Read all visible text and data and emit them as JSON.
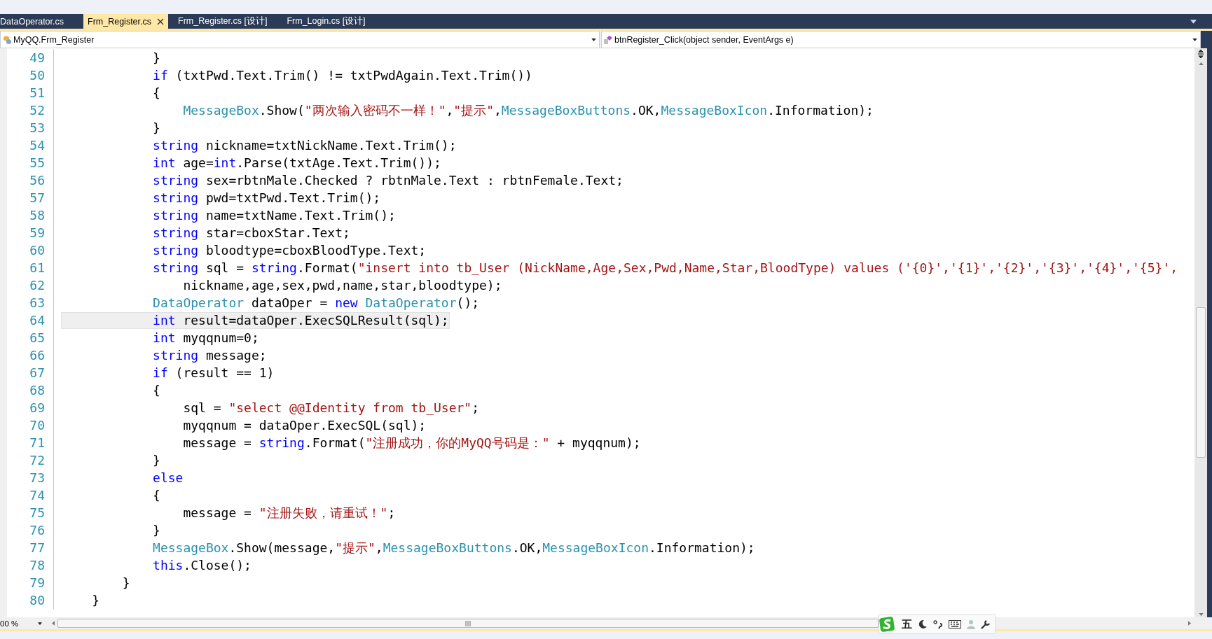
{
  "tabs": [
    {
      "label": "DataOperator.cs",
      "selected": false
    },
    {
      "label": "Frm_Register.cs",
      "selected": true
    },
    {
      "label": "Frm_Register.cs [设计]",
      "selected": false
    },
    {
      "label": "Frm_Login.cs [设计]",
      "selected": false
    }
  ],
  "navigation": {
    "class_combo": "MyQQ.Frm_Register",
    "member_combo": "btnRegister_Click(object sender, EventArgs e)"
  },
  "code_lines": [
    {
      "number": "49",
      "current": false,
      "tokens": [
        {
          "kind": "plain",
          "text": "            }"
        }
      ]
    },
    {
      "number": "50",
      "current": false,
      "tokens": [
        {
          "kind": "keyword",
          "text": "            if"
        },
        {
          "kind": "plain",
          "text": " (txtPwd.Text.Trim() != txtPwdAgain.Text.Trim())"
        }
      ]
    },
    {
      "number": "51",
      "current": false,
      "tokens": [
        {
          "kind": "plain",
          "text": "            {"
        }
      ]
    },
    {
      "number": "52",
      "current": false,
      "tokens": [
        {
          "kind": "type",
          "text": "                MessageBox"
        },
        {
          "kind": "plain",
          "text": ".Show("
        },
        {
          "kind": "string",
          "text": "\"两次输入密码不一样！\""
        },
        {
          "kind": "plain",
          "text": ","
        },
        {
          "kind": "string",
          "text": "\"提示\""
        },
        {
          "kind": "plain",
          "text": ","
        },
        {
          "kind": "type",
          "text": "MessageBoxButtons"
        },
        {
          "kind": "plain",
          "text": ".OK,"
        },
        {
          "kind": "type",
          "text": "MessageBoxIcon"
        },
        {
          "kind": "plain",
          "text": ".Information);"
        }
      ]
    },
    {
      "number": "53",
      "current": false,
      "tokens": [
        {
          "kind": "plain",
          "text": "            }"
        }
      ]
    },
    {
      "number": "54",
      "current": false,
      "tokens": [
        {
          "kind": "keyword",
          "text": "            string"
        },
        {
          "kind": "plain",
          "text": " nickname=txtNickName.Text.Trim();"
        }
      ]
    },
    {
      "number": "55",
      "current": false,
      "tokens": [
        {
          "kind": "keyword",
          "text": "            int"
        },
        {
          "kind": "plain",
          "text": " age="
        },
        {
          "kind": "keyword",
          "text": "int"
        },
        {
          "kind": "plain",
          "text": ".Parse(txtAge.Text.Trim());"
        }
      ]
    },
    {
      "number": "56",
      "current": false,
      "tokens": [
        {
          "kind": "keyword",
          "text": "            string"
        },
        {
          "kind": "plain",
          "text": " sex=rbtnMale.Checked ? rbtnMale.Text : rbtnFemale.Text;"
        }
      ]
    },
    {
      "number": "57",
      "current": false,
      "tokens": [
        {
          "kind": "keyword",
          "text": "            string"
        },
        {
          "kind": "plain",
          "text": " pwd=txtPwd.Text.Trim();"
        }
      ]
    },
    {
      "number": "58",
      "current": false,
      "tokens": [
        {
          "kind": "keyword",
          "text": "            string"
        },
        {
          "kind": "plain",
          "text": " name=txtName.Text.Trim();"
        }
      ]
    },
    {
      "number": "59",
      "current": false,
      "tokens": [
        {
          "kind": "keyword",
          "text": "            string"
        },
        {
          "kind": "plain",
          "text": " star=cboxStar.Text;"
        }
      ]
    },
    {
      "number": "60",
      "current": false,
      "tokens": [
        {
          "kind": "keyword",
          "text": "            string"
        },
        {
          "kind": "plain",
          "text": " bloodtype=cboxBloodType.Text;"
        }
      ]
    },
    {
      "number": "61",
      "current": false,
      "tokens": [
        {
          "kind": "keyword",
          "text": "            string"
        },
        {
          "kind": "plain",
          "text": " sql = "
        },
        {
          "kind": "keyword",
          "text": "string"
        },
        {
          "kind": "plain",
          "text": ".Format("
        },
        {
          "kind": "string",
          "text": "\"insert into tb_User (NickName,Age,Sex,Pwd,Name,Star,BloodType) values ('{0}','{1}','{2}','{3}','{4}','{5}',"
        }
      ]
    },
    {
      "number": "62",
      "current": false,
      "tokens": [
        {
          "kind": "plain",
          "text": "                nickname,age,sex,pwd,name,star,bloodtype);"
        }
      ]
    },
    {
      "number": "63",
      "current": false,
      "tokens": [
        {
          "kind": "type",
          "text": "            DataOperator"
        },
        {
          "kind": "plain",
          "text": " dataOper = "
        },
        {
          "kind": "keyword",
          "text": "new"
        },
        {
          "kind": "type",
          "text": " DataOperator"
        },
        {
          "kind": "plain",
          "text": "();"
        }
      ]
    },
    {
      "number": "64",
      "current": true,
      "tokens": [
        {
          "kind": "keyword",
          "text": "            int"
        },
        {
          "kind": "plain",
          "text": " result=dataOper.ExecSQLResult(sql);"
        }
      ]
    },
    {
      "number": "65",
      "current": false,
      "tokens": [
        {
          "kind": "keyword",
          "text": "            int"
        },
        {
          "kind": "plain",
          "text": " myqqnum=0;"
        }
      ]
    },
    {
      "number": "66",
      "current": false,
      "tokens": [
        {
          "kind": "keyword",
          "text": "            string"
        },
        {
          "kind": "plain",
          "text": " message;"
        }
      ]
    },
    {
      "number": "67",
      "current": false,
      "tokens": [
        {
          "kind": "keyword",
          "text": "            if"
        },
        {
          "kind": "plain",
          "text": " (result == 1)"
        }
      ]
    },
    {
      "number": "68",
      "current": false,
      "tokens": [
        {
          "kind": "plain",
          "text": "            {"
        }
      ]
    },
    {
      "number": "69",
      "current": false,
      "tokens": [
        {
          "kind": "plain",
          "text": "                sql = "
        },
        {
          "kind": "string",
          "text": "\"select @@Identity from tb_User\""
        },
        {
          "kind": "plain",
          "text": ";"
        }
      ]
    },
    {
      "number": "70",
      "current": false,
      "tokens": [
        {
          "kind": "plain",
          "text": "                myqqnum = dataOper.ExecSQL(sql);"
        }
      ]
    },
    {
      "number": "71",
      "current": false,
      "tokens": [
        {
          "kind": "plain",
          "text": "                message = "
        },
        {
          "kind": "keyword",
          "text": "string"
        },
        {
          "kind": "plain",
          "text": ".Format("
        },
        {
          "kind": "string",
          "text": "\"注册成功，你的MyQQ号码是：\""
        },
        {
          "kind": "plain",
          "text": " + myqqnum);"
        }
      ]
    },
    {
      "number": "72",
      "current": false,
      "tokens": [
        {
          "kind": "plain",
          "text": "            }"
        }
      ]
    },
    {
      "number": "73",
      "current": false,
      "tokens": [
        {
          "kind": "keyword",
          "text": "            else"
        }
      ]
    },
    {
      "number": "74",
      "current": false,
      "tokens": [
        {
          "kind": "plain",
          "text": "            {"
        }
      ]
    },
    {
      "number": "75",
      "current": false,
      "tokens": [
        {
          "kind": "plain",
          "text": "                message = "
        },
        {
          "kind": "string",
          "text": "\"注册失败，请重试！\""
        },
        {
          "kind": "plain",
          "text": ";"
        }
      ]
    },
    {
      "number": "76",
      "current": false,
      "tokens": [
        {
          "kind": "plain",
          "text": "            }"
        }
      ]
    },
    {
      "number": "77",
      "current": false,
      "tokens": [
        {
          "kind": "type",
          "text": "            MessageBox"
        },
        {
          "kind": "plain",
          "text": ".Show(message,"
        },
        {
          "kind": "string",
          "text": "\"提示\""
        },
        {
          "kind": "plain",
          "text": ","
        },
        {
          "kind": "type",
          "text": "MessageBoxButtons"
        },
        {
          "kind": "plain",
          "text": ".OK,"
        },
        {
          "kind": "type",
          "text": "MessageBoxIcon"
        },
        {
          "kind": "plain",
          "text": ".Information);"
        }
      ]
    },
    {
      "number": "78",
      "current": false,
      "tokens": [
        {
          "kind": "keyword",
          "text": "            this"
        },
        {
          "kind": "plain",
          "text": ".Close();"
        }
      ]
    },
    {
      "number": "79",
      "current": false,
      "tokens": [
        {
          "kind": "plain",
          "text": "        }"
        }
      ]
    },
    {
      "number": "80",
      "current": false,
      "tokens": [
        {
          "kind": "plain",
          "text": "    }"
        }
      ]
    }
  ],
  "status_bar": {
    "zoom": "00 %"
  },
  "ime_toolbar": {
    "mode": "五"
  }
}
